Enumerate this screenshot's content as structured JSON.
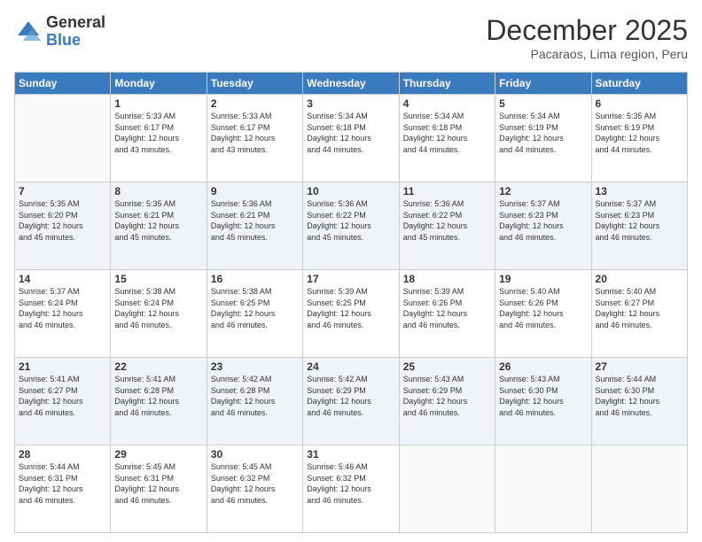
{
  "logo": {
    "general": "General",
    "blue": "Blue"
  },
  "header": {
    "title": "December 2025",
    "subtitle": "Pacaraos, Lima region, Peru"
  },
  "weekdays": [
    "Sunday",
    "Monday",
    "Tuesday",
    "Wednesday",
    "Thursday",
    "Friday",
    "Saturday"
  ],
  "weeks": [
    [
      {
        "day": "",
        "sunrise": "",
        "sunset": "",
        "daylight": ""
      },
      {
        "day": "1",
        "sunrise": "Sunrise: 5:33 AM",
        "sunset": "Sunset: 6:17 PM",
        "daylight": "Daylight: 12 hours and 43 minutes."
      },
      {
        "day": "2",
        "sunrise": "Sunrise: 5:33 AM",
        "sunset": "Sunset: 6:17 PM",
        "daylight": "Daylight: 12 hours and 43 minutes."
      },
      {
        "day": "3",
        "sunrise": "Sunrise: 5:34 AM",
        "sunset": "Sunset: 6:18 PM",
        "daylight": "Daylight: 12 hours and 44 minutes."
      },
      {
        "day": "4",
        "sunrise": "Sunrise: 5:34 AM",
        "sunset": "Sunset: 6:18 PM",
        "daylight": "Daylight: 12 hours and 44 minutes."
      },
      {
        "day": "5",
        "sunrise": "Sunrise: 5:34 AM",
        "sunset": "Sunset: 6:19 PM",
        "daylight": "Daylight: 12 hours and 44 minutes."
      },
      {
        "day": "6",
        "sunrise": "Sunrise: 5:35 AM",
        "sunset": "Sunset: 6:19 PM",
        "daylight": "Daylight: 12 hours and 44 minutes."
      }
    ],
    [
      {
        "day": "7",
        "sunrise": "Sunrise: 5:35 AM",
        "sunset": "Sunset: 6:20 PM",
        "daylight": "Daylight: 12 hours and 45 minutes."
      },
      {
        "day": "8",
        "sunrise": "Sunrise: 5:35 AM",
        "sunset": "Sunset: 6:21 PM",
        "daylight": "Daylight: 12 hours and 45 minutes."
      },
      {
        "day": "9",
        "sunrise": "Sunrise: 5:36 AM",
        "sunset": "Sunset: 6:21 PM",
        "daylight": "Daylight: 12 hours and 45 minutes."
      },
      {
        "day": "10",
        "sunrise": "Sunrise: 5:36 AM",
        "sunset": "Sunset: 6:22 PM",
        "daylight": "Daylight: 12 hours and 45 minutes."
      },
      {
        "day": "11",
        "sunrise": "Sunrise: 5:36 AM",
        "sunset": "Sunset: 6:22 PM",
        "daylight": "Daylight: 12 hours and 45 minutes."
      },
      {
        "day": "12",
        "sunrise": "Sunrise: 5:37 AM",
        "sunset": "Sunset: 6:23 PM",
        "daylight": "Daylight: 12 hours and 46 minutes."
      },
      {
        "day": "13",
        "sunrise": "Sunrise: 5:37 AM",
        "sunset": "Sunset: 6:23 PM",
        "daylight": "Daylight: 12 hours and 46 minutes."
      }
    ],
    [
      {
        "day": "14",
        "sunrise": "Sunrise: 5:37 AM",
        "sunset": "Sunset: 6:24 PM",
        "daylight": "Daylight: 12 hours and 46 minutes."
      },
      {
        "day": "15",
        "sunrise": "Sunrise: 5:38 AM",
        "sunset": "Sunset: 6:24 PM",
        "daylight": "Daylight: 12 hours and 46 minutes."
      },
      {
        "day": "16",
        "sunrise": "Sunrise: 5:38 AM",
        "sunset": "Sunset: 6:25 PM",
        "daylight": "Daylight: 12 hours and 46 minutes."
      },
      {
        "day": "17",
        "sunrise": "Sunrise: 5:39 AM",
        "sunset": "Sunset: 6:25 PM",
        "daylight": "Daylight: 12 hours and 46 minutes."
      },
      {
        "day": "18",
        "sunrise": "Sunrise: 5:39 AM",
        "sunset": "Sunset: 6:26 PM",
        "daylight": "Daylight: 12 hours and 46 minutes."
      },
      {
        "day": "19",
        "sunrise": "Sunrise: 5:40 AM",
        "sunset": "Sunset: 6:26 PM",
        "daylight": "Daylight: 12 hours and 46 minutes."
      },
      {
        "day": "20",
        "sunrise": "Sunrise: 5:40 AM",
        "sunset": "Sunset: 6:27 PM",
        "daylight": "Daylight: 12 hours and 46 minutes."
      }
    ],
    [
      {
        "day": "21",
        "sunrise": "Sunrise: 5:41 AM",
        "sunset": "Sunset: 6:27 PM",
        "daylight": "Daylight: 12 hours and 46 minutes."
      },
      {
        "day": "22",
        "sunrise": "Sunrise: 5:41 AM",
        "sunset": "Sunset: 6:28 PM",
        "daylight": "Daylight: 12 hours and 46 minutes."
      },
      {
        "day": "23",
        "sunrise": "Sunrise: 5:42 AM",
        "sunset": "Sunset: 6:28 PM",
        "daylight": "Daylight: 12 hours and 46 minutes."
      },
      {
        "day": "24",
        "sunrise": "Sunrise: 5:42 AM",
        "sunset": "Sunset: 6:29 PM",
        "daylight": "Daylight: 12 hours and 46 minutes."
      },
      {
        "day": "25",
        "sunrise": "Sunrise: 5:43 AM",
        "sunset": "Sunset: 6:29 PM",
        "daylight": "Daylight: 12 hours and 46 minutes."
      },
      {
        "day": "26",
        "sunrise": "Sunrise: 5:43 AM",
        "sunset": "Sunset: 6:30 PM",
        "daylight": "Daylight: 12 hours and 46 minutes."
      },
      {
        "day": "27",
        "sunrise": "Sunrise: 5:44 AM",
        "sunset": "Sunset: 6:30 PM",
        "daylight": "Daylight: 12 hours and 46 minutes."
      }
    ],
    [
      {
        "day": "28",
        "sunrise": "Sunrise: 5:44 AM",
        "sunset": "Sunset: 6:31 PM",
        "daylight": "Daylight: 12 hours and 46 minutes."
      },
      {
        "day": "29",
        "sunrise": "Sunrise: 5:45 AM",
        "sunset": "Sunset: 6:31 PM",
        "daylight": "Daylight: 12 hours and 46 minutes."
      },
      {
        "day": "30",
        "sunrise": "Sunrise: 5:45 AM",
        "sunset": "Sunset: 6:32 PM",
        "daylight": "Daylight: 12 hours and 46 minutes."
      },
      {
        "day": "31",
        "sunrise": "Sunrise: 5:46 AM",
        "sunset": "Sunset: 6:32 PM",
        "daylight": "Daylight: 12 hours and 46 minutes."
      },
      {
        "day": "",
        "sunrise": "",
        "sunset": "",
        "daylight": ""
      },
      {
        "day": "",
        "sunrise": "",
        "sunset": "",
        "daylight": ""
      },
      {
        "day": "",
        "sunrise": "",
        "sunset": "",
        "daylight": ""
      }
    ]
  ]
}
